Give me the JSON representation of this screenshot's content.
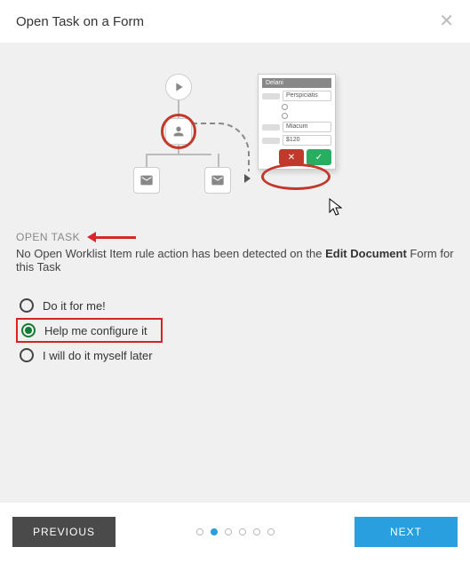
{
  "header": {
    "title": "Open Task on a Form"
  },
  "illustration": {
    "panel_title": "Delani",
    "field1": "Perspiciatis",
    "field2": "Miacum",
    "field3": "$120"
  },
  "task": {
    "label": "OPEN TASK",
    "desc_pre": "No Open Worklist Item rule action has been detected on the ",
    "desc_bold": "Edit Document",
    "desc_post": " Form for this Task"
  },
  "options": [
    {
      "label": "Do it for me!",
      "selected": false
    },
    {
      "label": "Help me configure it",
      "selected": true
    },
    {
      "label": "I will do it myself later",
      "selected": false
    }
  ],
  "footer": {
    "prev": "PREVIOUS",
    "next": "NEXT",
    "dots_total": 6,
    "dots_active": 1
  }
}
